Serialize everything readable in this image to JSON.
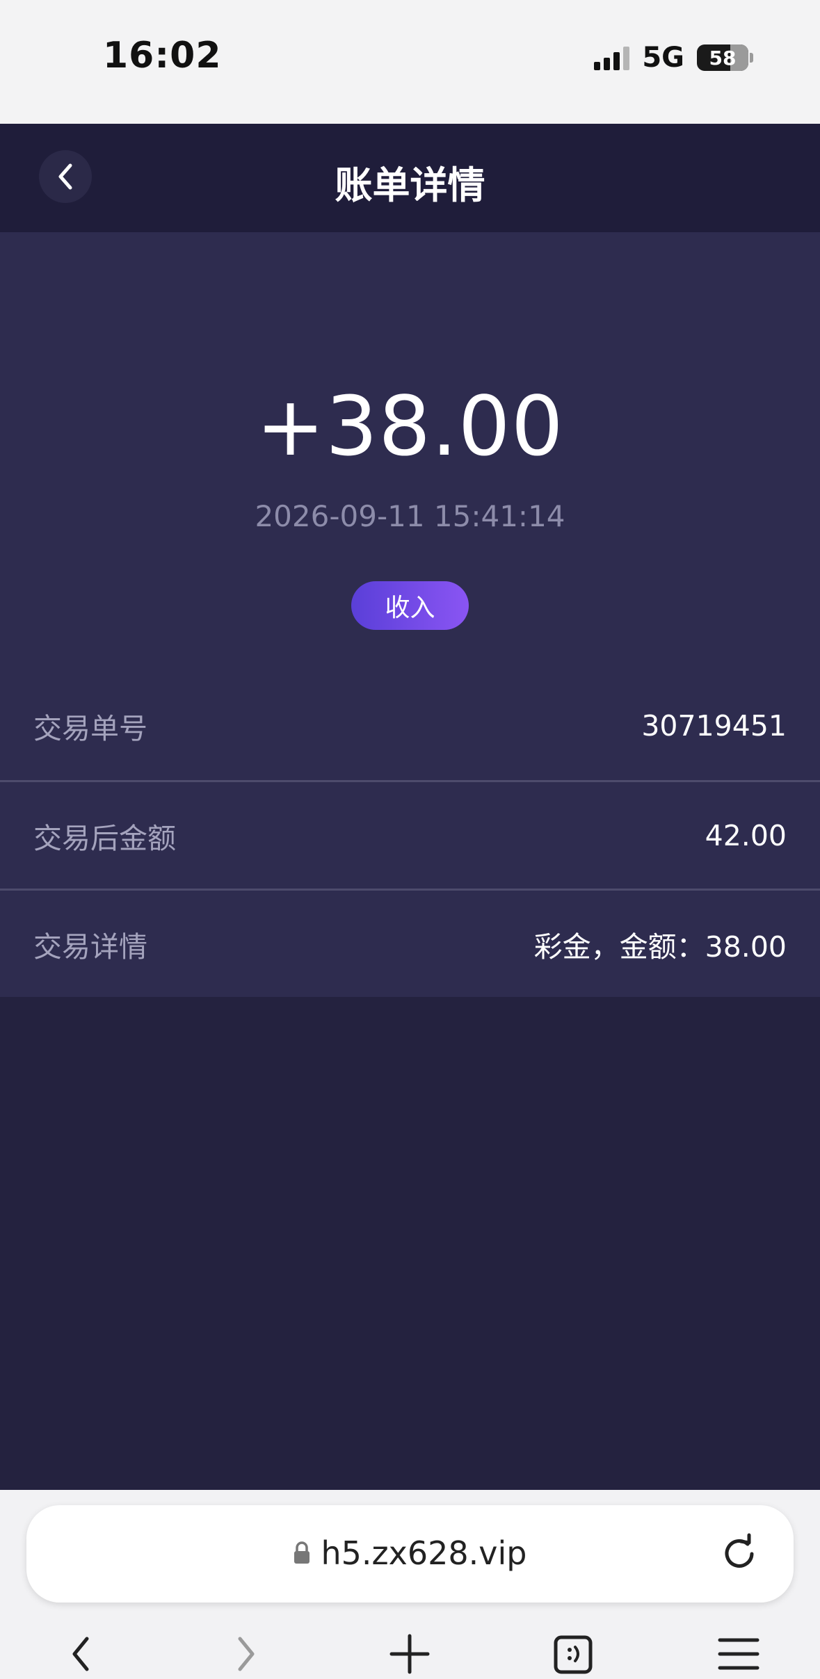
{
  "status_bar": {
    "time": "16:02",
    "network": "5G",
    "battery": "58"
  },
  "header": {
    "title": "账单详情"
  },
  "summary": {
    "amount": "+38.00",
    "time": "2026-09-11 15:41:14",
    "type_badge": "收入"
  },
  "details": [
    {
      "label": "交易单号",
      "value": "30719451"
    },
    {
      "label": "交易后金额",
      "value": "42.00"
    },
    {
      "label": "交易详情",
      "value": "彩金，金额：38.00"
    }
  ],
  "browser": {
    "url": "h5.zx628.vip"
  },
  "icons": {
    "back": "chevron-left-icon",
    "lock": "lock-icon",
    "reload": "reload-icon",
    "nav_back": "chevron-left-icon",
    "nav_forward": "chevron-right-icon",
    "new_tab": "plus-icon",
    "tabs": "tabs-icon",
    "menu": "menu-icon"
  },
  "colors": {
    "header_bg": "#1f1d3a",
    "card_bg": "#2e2c4f",
    "page_bg": "#24223f",
    "badge_start": "#5a3fd8",
    "badge_end": "#8a55f3"
  }
}
